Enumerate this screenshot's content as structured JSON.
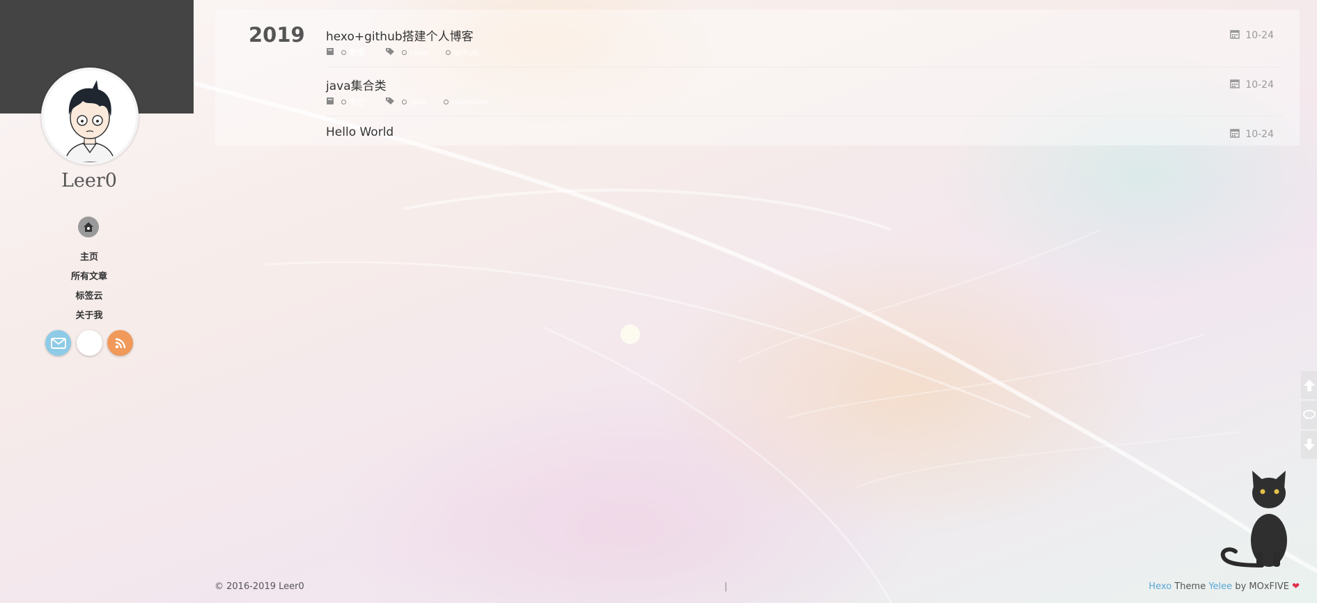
{
  "sidebar": {
    "author_name": "Leer0",
    "nav": [
      {
        "label": "主页"
      },
      {
        "label": "所有文章"
      },
      {
        "label": "标签云"
      },
      {
        "label": "关于我"
      }
    ],
    "social": [
      {
        "icon": "email-icon",
        "color": "#8ecbe6"
      },
      {
        "icon": "github-icon",
        "color": "#ffffff"
      },
      {
        "icon": "rss-icon",
        "color": "#f0995a"
      }
    ]
  },
  "archive": {
    "year": "2019",
    "posts": [
      {
        "title": "hexo+github搭建个人博客",
        "date": "10-24",
        "category": "教程",
        "tags": [
          "hexo",
          "github"
        ]
      },
      {
        "title": "java集合类",
        "date": "10-24",
        "category": "笔记",
        "tags": [
          "java",
          "collection"
        ]
      },
      {
        "title": "Hello World",
        "date": "10-24"
      }
    ]
  },
  "footer": {
    "copyright": "© 2016-2019 Leer0",
    "separator": "|",
    "credit_hexo": "Hexo",
    "credit_theme_word": "Theme",
    "credit_theme": "Yelee",
    "credit_by": "by MOxFIVE",
    "heart": "❤"
  },
  "colors": {
    "sidebar_top": "#444444",
    "link": "#5aa7d6",
    "heart": "#e0304a"
  }
}
